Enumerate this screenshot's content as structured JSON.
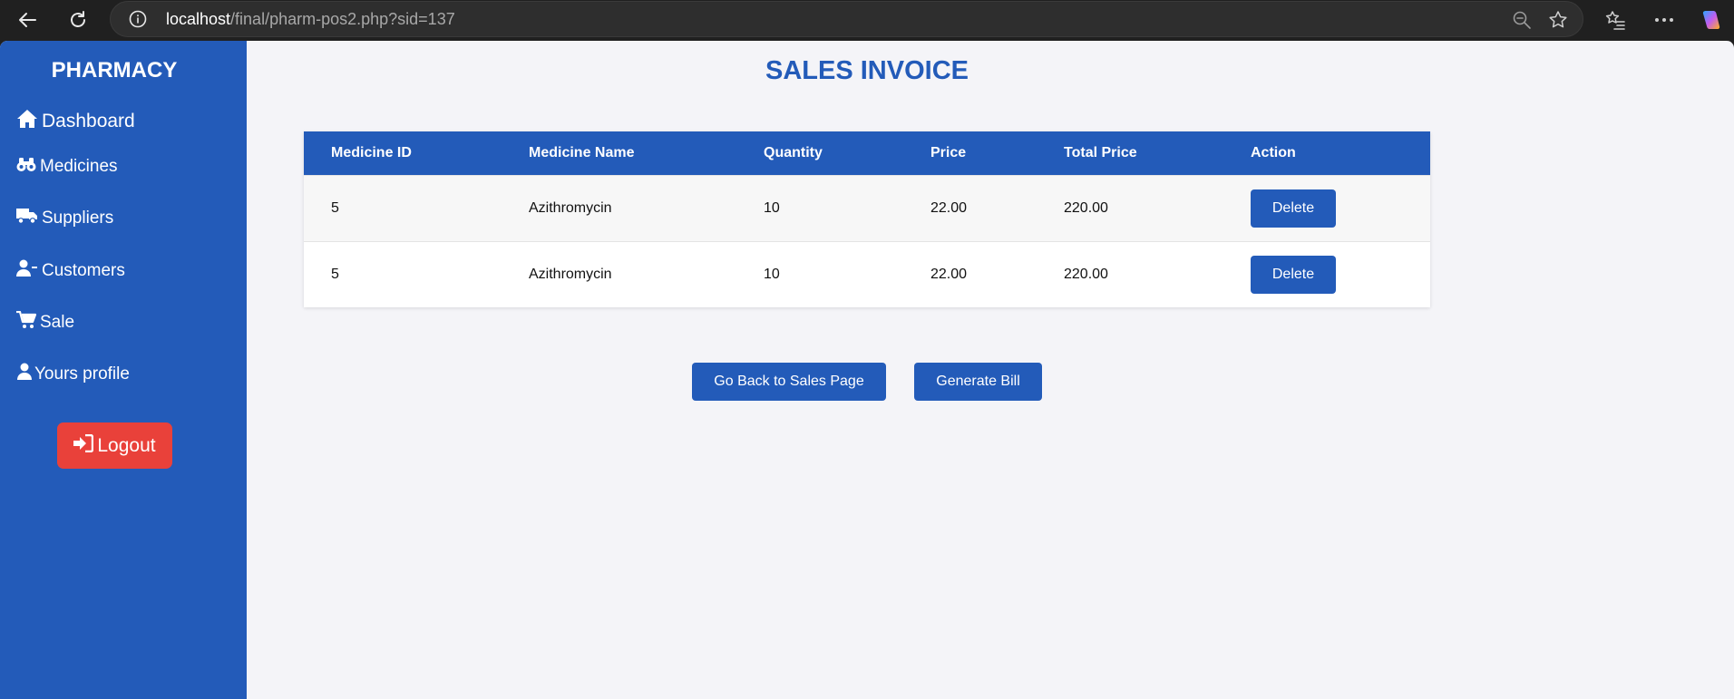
{
  "browser": {
    "url_host": "localhost",
    "url_path": "/final/pharm-pos2.php?sid=137"
  },
  "sidebar": {
    "brand": "PHARMACY",
    "items": [
      {
        "label": "Dashboard",
        "icon": "home-icon"
      },
      {
        "label": "Medicines",
        "icon": "binoculars-icon"
      },
      {
        "label": "Suppliers",
        "icon": "truck-icon"
      },
      {
        "label": "Customers",
        "icon": "user-minus-icon"
      },
      {
        "label": "Sale",
        "icon": "cart-icon"
      },
      {
        "label": "Yours profile",
        "icon": "user-icon"
      }
    ],
    "logout_label": "Logout"
  },
  "main": {
    "title": "SALES INVOICE",
    "table": {
      "headers": [
        "Medicine ID",
        "Medicine Name",
        "Quantity",
        "Price",
        "Total Price",
        "Action"
      ],
      "rows": [
        {
          "id": "5",
          "name": "Azithromycin",
          "quantity": "10",
          "price": "22.00",
          "total": "220.00",
          "action": "Delete"
        },
        {
          "id": "5",
          "name": "Azithromycin",
          "quantity": "10",
          "price": "22.00",
          "total": "220.00",
          "action": "Delete"
        }
      ]
    },
    "buttons": {
      "back": "Go Back to Sales Page",
      "generate": "Generate Bill"
    }
  },
  "colors": {
    "primary": "#235bb9",
    "danger": "#e9413a",
    "page_bg": "#f4f4f8"
  }
}
